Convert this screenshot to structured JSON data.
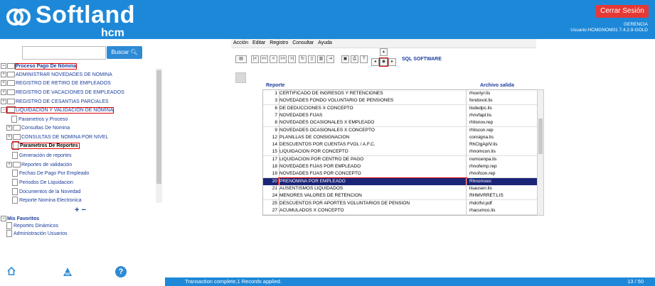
{
  "header": {
    "brand": "Softland",
    "tm": "™",
    "product": "hcm",
    "logout_label": "Cerrar Sesión",
    "company": "GERENCIA",
    "user_line": "Usuario:HCMGNOM01 7.4.2.9-GOLD",
    "colors": {
      "bar": "#1e88d8",
      "logout": "#e53935"
    }
  },
  "sidebar": {
    "search_placeholder": "",
    "search_label": "Buscar",
    "tree": [
      {
        "label": "Proceso Pago De Nómina"
      },
      {
        "label": "ADMINISTRAR NOVEDADES DE NOMINA"
      },
      {
        "label": "REGISTRO DE RETIRO DE EMPLEADOS"
      },
      {
        "label": "REGISTRO DE VACACIONES DE EMPLEADOS"
      },
      {
        "label": "REGISTRO DE CESANTIAS PARCIALES"
      },
      {
        "label": "LIQUIDACIÓN Y VALIDACIÓN DE NÓMINA"
      },
      {
        "label": "Parametros y Proceso"
      },
      {
        "label": "Consultas De Nomina"
      },
      {
        "label": "CONSULTAS DE NOMINA POR NIVEL"
      },
      {
        "label": "Parametros De Reportes"
      },
      {
        "label": "Generación de reportes"
      },
      {
        "label": "Reportes de validación"
      },
      {
        "label": "Fechas De Pago Por Empleado"
      },
      {
        "label": "Periodos De Liquidacion"
      },
      {
        "label": "Documentos de la Novedad"
      },
      {
        "label": "Reporte Nomina Electronica"
      }
    ],
    "plus": "+",
    "minus": "−",
    "favorites": [
      {
        "label": "Mis Favoritos"
      },
      {
        "label": "Reportes Dinámicos"
      },
      {
        "label": "Administración Usuarios"
      }
    ],
    "bottom_icons": [
      "home-icon",
      "triangle-stack-icon",
      "help-icon"
    ],
    "help_glyph": "?"
  },
  "menu": [
    "Acción",
    "Editar",
    "Registro",
    "Consultar",
    "Ayuda"
  ],
  "toolbar": {
    "vendor": "SQL SOFTWARE"
  },
  "grid": {
    "col_reporte": "Reporte",
    "col_archivo": "Archivo salida",
    "rows": [
      {
        "n": "1",
        "r": "CERTIFICADO DE INGRESOS Y RETENCIONES",
        "f": "rhceriyr.lis"
      },
      {
        "n": "3",
        "r": "NOVEDADES FONDO VOLUNTARIO DE PENSIONES",
        "f": "fondovol.lis"
      },
      {
        "n": "6",
        "r": "DE DEDUCCIONES X CONCEPTO",
        "f": "lisdedpc.lis"
      },
      {
        "n": "7",
        "r": "NOVEDADES FIJAS",
        "f": "rhnvfapl.lis"
      },
      {
        "n": "8",
        "r": "NOVEDADES OCASIONALES X EMPLEADO",
        "f": "rhlisnov.rep"
      },
      {
        "n": "9",
        "r": "NOVEDADES OCASIONALES X CONCEPTO",
        "f": "rhliscon.rep"
      },
      {
        "n": "12",
        "r": "PLANILLAS DE CONSIGNACION",
        "f": "consigna.lis"
      },
      {
        "n": "14",
        "r": "DESCUENTOS POR CUENTAS FVOL / A.F.C.",
        "f": "RhCtgAplV.lis"
      },
      {
        "n": "15",
        "r": "LIQUIDACION POR CONCEPTO",
        "f": "rhnomcon.lis"
      },
      {
        "n": "17",
        "r": "LIQUIDACION POR CENTRO DE PAGO",
        "f": "nomcenpa.lis"
      },
      {
        "n": "18",
        "r": "NOVEDADES FIJAS POR EMPLEADO",
        "f": "rhnofemp.rep"
      },
      {
        "n": "19",
        "r": "NOVEDADES FIJAS POR CONCEPTO",
        "f": "rhnofcon.rep"
      },
      {
        "n": "20",
        "r": "PRENOMINA POR EMPLEADO",
        "f": "Rhnomxec",
        "selected": true
      },
      {
        "n": "21",
        "r": "AUSENTISMOS LIQUIDADOS",
        "f": "lisausen.lis"
      },
      {
        "n": "24",
        "r": "MENORES VALORES DE RETENCION",
        "f": "RHMVRRET.LIS"
      },
      {
        "n": "25",
        "r": "DESCUENTOS POR APORTES VOLUNTARIOS DE PENSION",
        "f": "rhdctfvl.pdf"
      },
      {
        "n": "27",
        "r": "ACUMULADOS X CONCEPTO",
        "f": "rhacumco.lis"
      }
    ],
    "selected_color": "#1a2578"
  },
  "status": {
    "message": "Transaction complete,1 Records applied.",
    "page": "13 / 50"
  }
}
